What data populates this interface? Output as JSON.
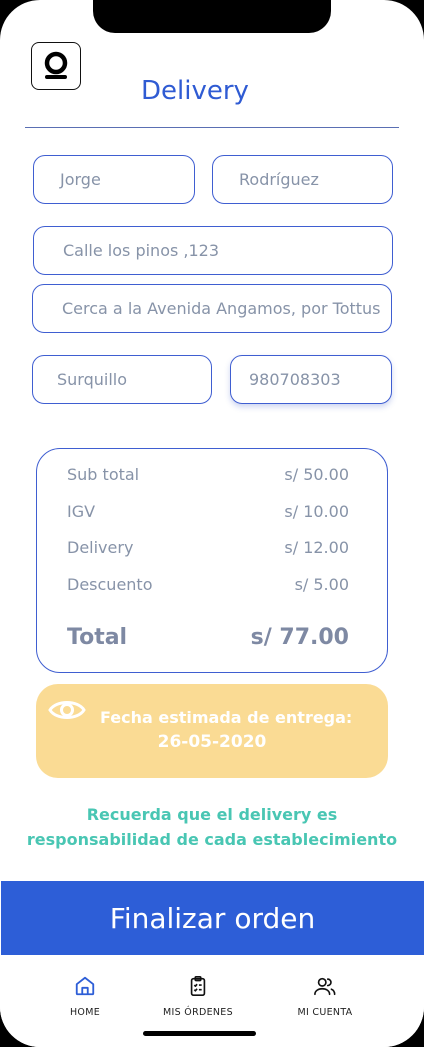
{
  "header": {
    "title": "Delivery",
    "logo_icon": "brand-logo-icon"
  },
  "form": {
    "first_name": "Jorge",
    "last_name": "Rodríguez",
    "address": "Calle los pinos ,123",
    "reference": "Cerca a la Avenida Angamos, por Tottus",
    "district": "Surquillo",
    "phone": "980708303"
  },
  "summary": {
    "subtotal_label": "Sub total",
    "subtotal_value": "s/ 50.00",
    "igv_label": "IGV",
    "igv_value": "s/ 10.00",
    "delivery_label": "Delivery",
    "delivery_value": "s/ 12.00",
    "discount_label": "Descuento",
    "discount_value": "s/ 5.00",
    "total_label": "Total",
    "total_value": "s/ 77.00"
  },
  "eta": {
    "icon": "eye-icon",
    "label": "Fecha estimada de entrega:",
    "date": "26-05-2020"
  },
  "reminder": {
    "line1": "Recuerda que el delivery es",
    "line2": "responsabilidad de cada establecimiento"
  },
  "cta": {
    "label": "Finalizar orden"
  },
  "tabs": [
    {
      "label": "HOME",
      "icon": "home-icon"
    },
    {
      "label": "MIS ÓRDENES",
      "icon": "clipboard-list-icon"
    },
    {
      "label": "MI CUENTA",
      "icon": "users-icon"
    }
  ],
  "colors": {
    "primary": "#2d5ed7",
    "eta_bg": "#fadb94",
    "reminder": "#49c6b3",
    "muted_text": "#8793a8"
  }
}
